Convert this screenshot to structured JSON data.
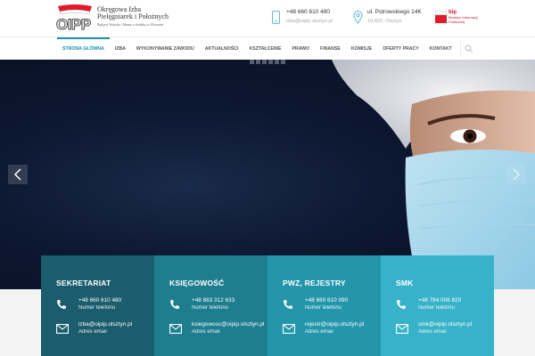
{
  "header": {
    "logo": {
      "acronym": "OIPP",
      "line1": "Okręgowa Izba",
      "line2": "Pielęgniarek i Położnych",
      "line3": "Będącej Wiejsko i Mazur z siedzibą w Olsztynie"
    },
    "phone": {
      "icon": "phone-icon",
      "number": "+48 660 610 480",
      "email": "izba@oipip.olsztyn.pl"
    },
    "address": {
      "icon": "map-pin-icon",
      "street": "ul. Pstrowskiego 14K",
      "city": "10-602, Olsztyn"
    },
    "bip": {
      "label": "bip",
      "caption": "Biuletyn Informacji Publicznej"
    }
  },
  "nav": {
    "items": [
      {
        "label": "Strona główna",
        "active": true
      },
      {
        "label": "Izba"
      },
      {
        "label": "Wykonywanie zawodu"
      },
      {
        "label": "Aktualności"
      },
      {
        "label": "Kształcenie"
      },
      {
        "label": "Prawo"
      },
      {
        "label": "Finanse"
      },
      {
        "label": "Komisje"
      },
      {
        "label": "Oferty pracy"
      },
      {
        "label": "Kontakt"
      }
    ],
    "search_icon": "search-icon"
  },
  "hero": {
    "slide_count": 6,
    "prev_icon": "chevron-left-icon",
    "next_icon": "chevron-right-icon"
  },
  "cards": [
    {
      "title": "SEKRETARIAT",
      "phone": "+48 660 610 480",
      "phone_label": "Numer telefonu",
      "email": "izba@oipip.olsztyn.pl",
      "email_label": "Adres email",
      "color": "#1b5c6d"
    },
    {
      "title": "KSIĘGOWOŚĆ",
      "phone": "+48 883 312 633",
      "phone_label": "Numer telefonu",
      "email": "ksiegowosc@oipip.olsztyn.pl",
      "email_label": "Adres email",
      "color": "#1e7d8f"
    },
    {
      "title": "PWZ, REJESTRY",
      "phone": "+48 660 610 090",
      "phone_label": "Numer telefonu",
      "email": "rejestr@oipip.olsztyn.pl",
      "email_label": "Adres email",
      "color": "#2496ab"
    },
    {
      "title": "SMK",
      "phone": "+48 784 006 820",
      "phone_label": "Numer telefonu",
      "email": "smk@oipip.olsztyn.pl",
      "email_label": "Adres email",
      "color": "#37b2c9"
    }
  ],
  "colors": {
    "accent": "#1a8fb0",
    "hero_bg": "#0c1730"
  }
}
